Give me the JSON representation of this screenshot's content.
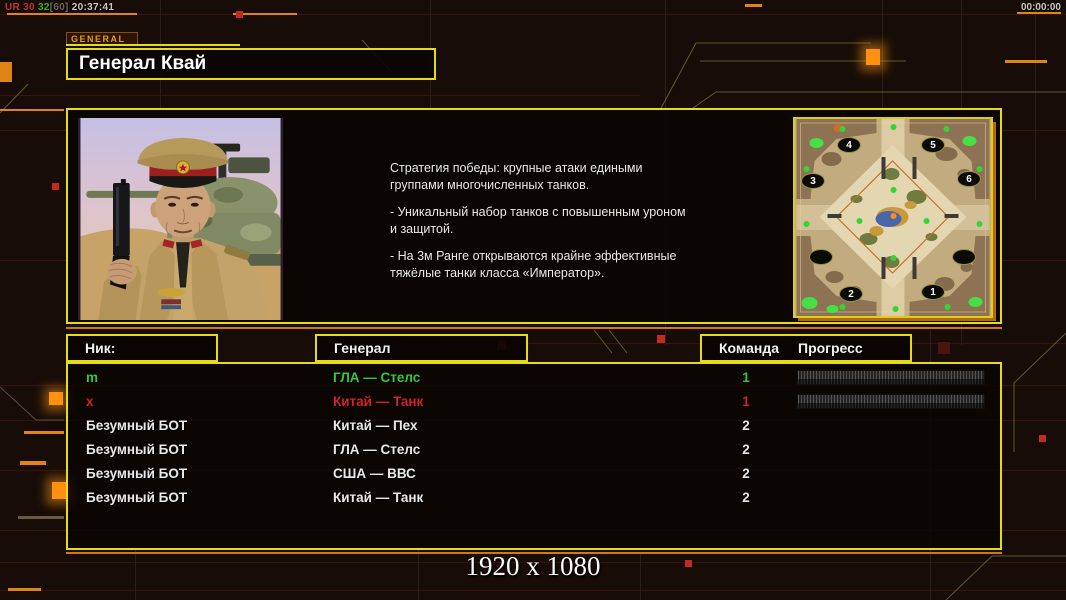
{
  "overlay": {
    "perf": {
      "label": "UR",
      "fps_current": "30",
      "fps_avg": "32",
      "fps_cap": "[60]",
      "clock": "20:37:41"
    },
    "mission_timer": "00:00:00"
  },
  "header": {
    "tab_label": "GENERAL",
    "title": "Генерал Квай"
  },
  "briefing": {
    "paragraphs": [
      "Стратегия победы: крупные атаки едиными\n группами многочисленных танков.",
      "- Уникальный набор танков с повышенным уроном\n и защитой.",
      "- На 3м Ранге открываются крайне эффективные\n тяжёлые танки класса «Император»."
    ]
  },
  "minimap": {
    "start_positions": [
      {
        "n": "4"
      },
      {
        "n": "5"
      },
      {
        "n": "3"
      },
      {
        "n": "6"
      },
      {
        "n": "2"
      },
      {
        "n": "1"
      }
    ]
  },
  "players": {
    "headers": {
      "nick": "Ник:",
      "general": "Генерал",
      "team": "Команда",
      "progress": "Прогресс"
    },
    "rows": [
      {
        "nick": "m",
        "general": "ГЛА — Стелс",
        "team": "1"
      },
      {
        "nick": "x",
        "general": "Китай — Танк",
        "team": "1"
      },
      {
        "nick": "Безумный БОТ",
        "general": "Китай — Пех",
        "team": "2"
      },
      {
        "nick": "Безумный БОТ",
        "general": "ГЛА — Стелс",
        "team": "2"
      },
      {
        "nick": "Безумный БОТ",
        "general": "США — ВВС",
        "team": "2"
      },
      {
        "nick": "Безумный БОТ",
        "general": "Китай — Танк",
        "team": "2"
      }
    ]
  },
  "footer": {
    "resolution": "1920 x 1080"
  },
  "colors": {
    "border_yellow": "#e5dc15",
    "accent_orange": "#cf7a12",
    "player_green": "#35c935",
    "player_red": "#d22424",
    "text_white": "#e9e9e9"
  }
}
